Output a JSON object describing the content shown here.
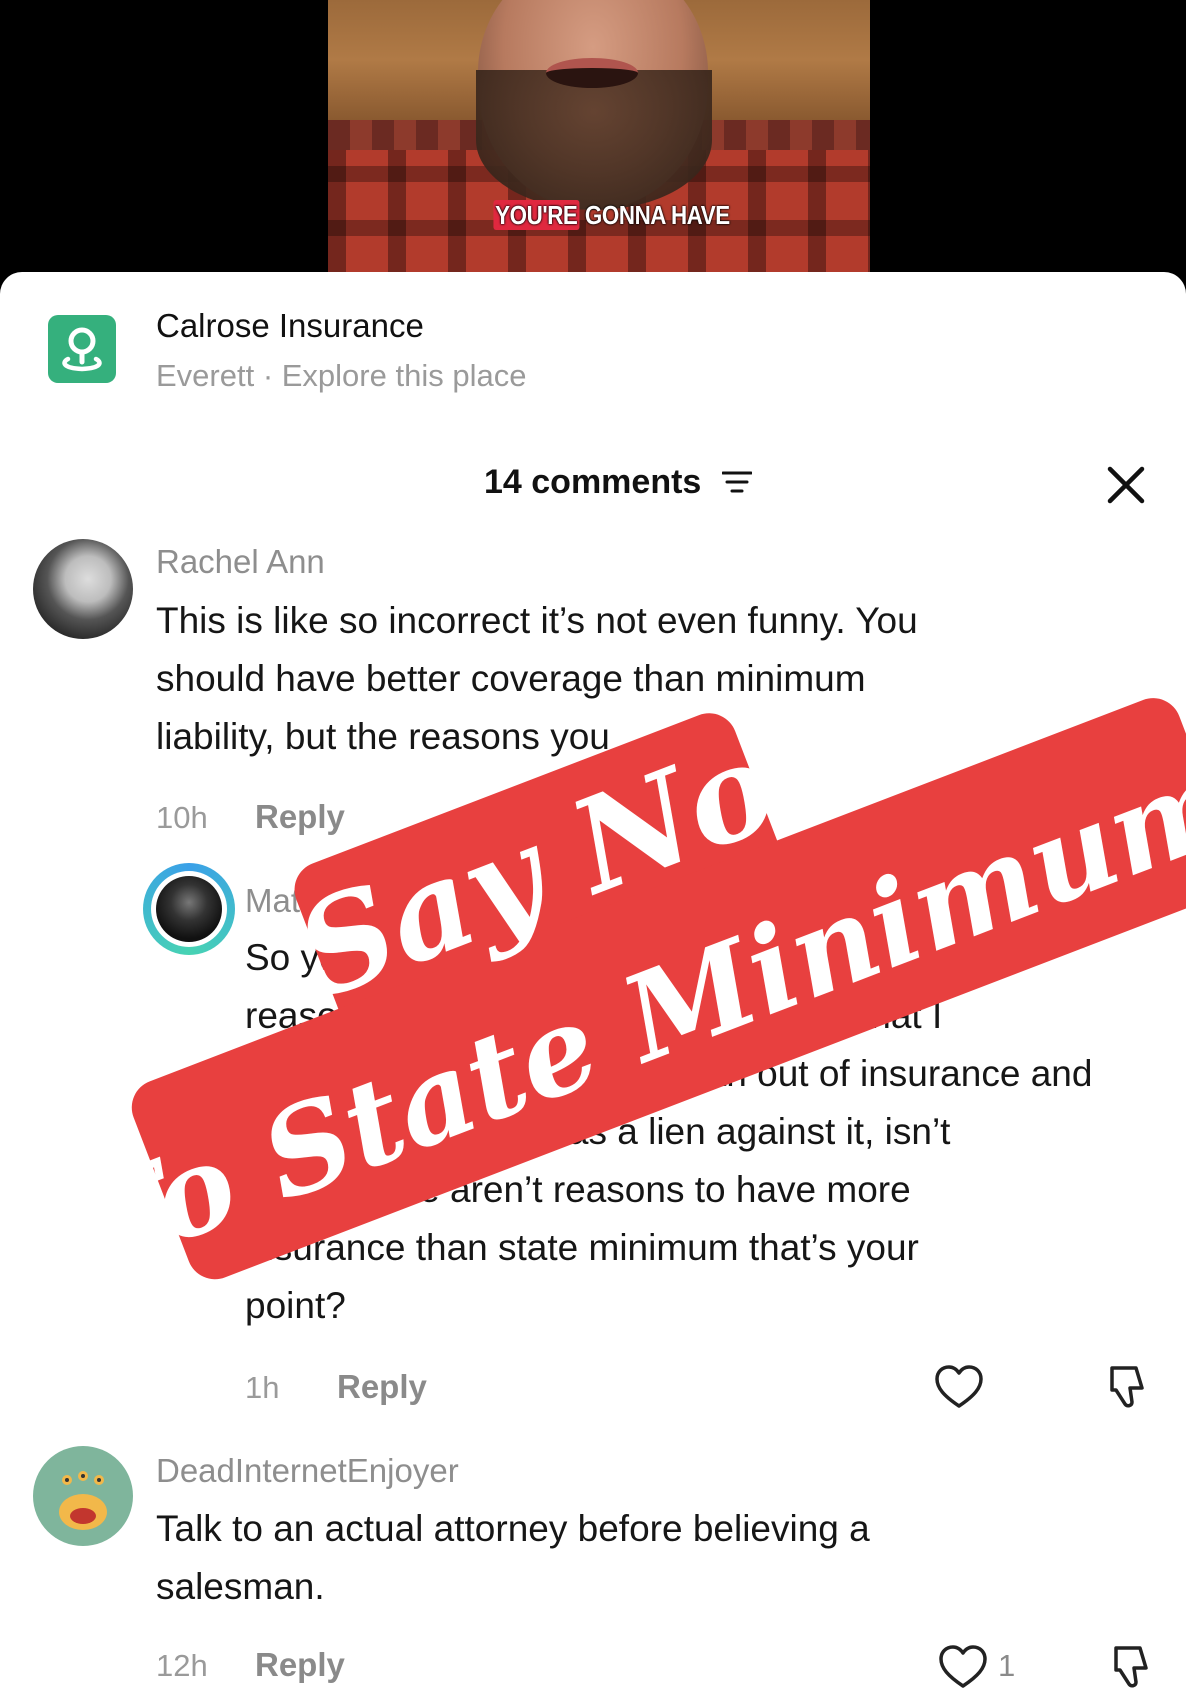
{
  "video": {
    "caption_highlight": "YOU'RE",
    "caption_rest": " GONNA HAVE"
  },
  "place": {
    "icon": "location-pin-icon",
    "name": "Calrose Insurance",
    "subtitle": "Everett · Explore this place"
  },
  "comments_header": {
    "count_label": "14 comments",
    "filter_icon": "filter-icon",
    "close_icon": "close-icon"
  },
  "comments": [
    {
      "user": "Rachel Ann",
      "lines": [
        "This is like so incorrect it’s not even funny. You",
        "should have better coverage than minimum",
        "liability, but the reasons you"
      ],
      "time": "10h",
      "reply_label": "Reply"
    },
    {
      "user": "Matt L",
      "lines": [
        "So you’re saying asset protection isn’t a",
        "reason to have more insurance? And that I",
        "was sued as a person who ran out of insurance and",
        "my house already has a lien against it, isn’t",
        "real? These aren’t reasons to have more",
        "insurance than state minimum that’s your",
        "point?"
      ],
      "time": "1h",
      "reply_label": "Reply"
    },
    {
      "user": "DeadInternetEnjoyer",
      "lines": [
        "Talk to an actual attorney before believing a",
        "salesman."
      ],
      "time": "12h",
      "reply_label": "Reply",
      "likes": "1"
    }
  ],
  "overlay": {
    "line1": "Say No",
    "line2": "To State Minimums",
    "color": "#e8403f"
  }
}
